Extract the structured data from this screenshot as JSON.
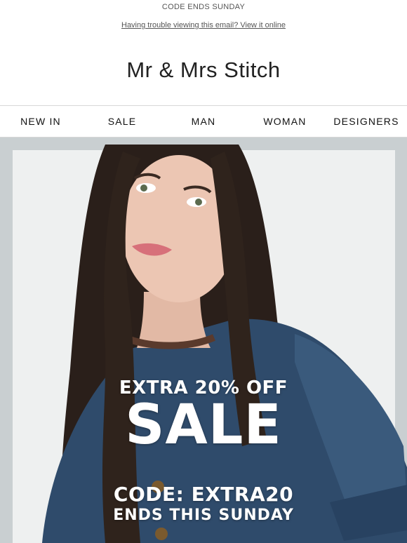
{
  "preheader": {
    "text": "CODE ENDS SUNDAY"
  },
  "view_online": {
    "text": "Having trouble viewing this email? View it online"
  },
  "brand": {
    "name": "Mr & Mrs Stitch"
  },
  "nav": {
    "items": [
      {
        "label": "NEW IN"
      },
      {
        "label": "SALE"
      },
      {
        "label": "MAN"
      },
      {
        "label": "WOMAN"
      },
      {
        "label": "DESIGNERS"
      }
    ]
  },
  "hero": {
    "line1": "EXTRA 20% OFF",
    "line2": "SALE",
    "line3": "CODE: EXTRA20",
    "line4": "ENDS THIS SUNDAY"
  },
  "colors": {
    "background": "#ffffff",
    "hero_backdrop": "#c9cfd1",
    "denim": "#2f4b6b",
    "hero_text": "#ffffff"
  }
}
